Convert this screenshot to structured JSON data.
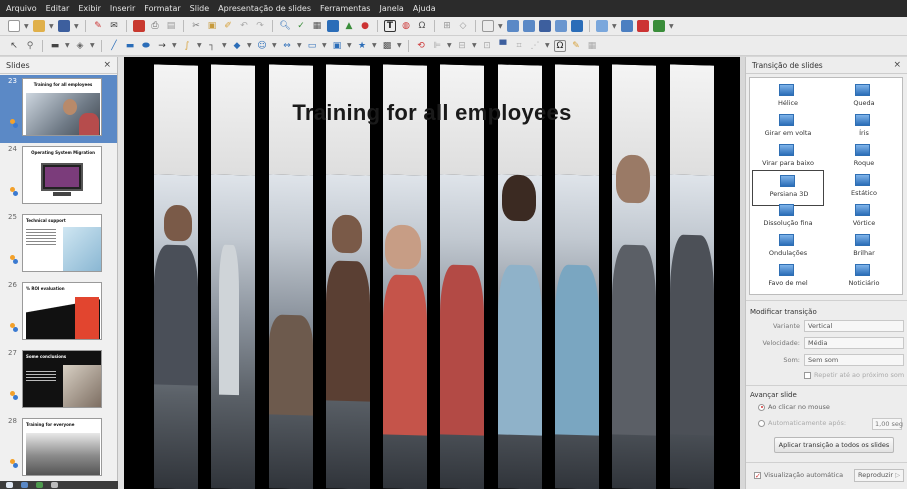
{
  "menu": [
    "Arquivo",
    "Editar",
    "Exibir",
    "Inserir",
    "Formatar",
    "Slide",
    "Apresentação de slides",
    "Ferramentas",
    "Janela",
    "Ajuda"
  ],
  "slides_pane": {
    "title": "Slides",
    "close": "×",
    "slides": [
      {
        "number": "23",
        "title": "Training for all employees",
        "selected": true
      },
      {
        "number": "24",
        "title": "Operating System Migration",
        "selected": false
      },
      {
        "number": "25",
        "title": "Technical support",
        "selected": false
      },
      {
        "number": "26",
        "title": "% ROI evaluation",
        "selected": false
      },
      {
        "number": "27",
        "title": "Some conclusions",
        "selected": false
      },
      {
        "number": "28",
        "title": "Training for everyone",
        "selected": false
      }
    ]
  },
  "stage": {
    "title": "Training for all employees"
  },
  "task_pane": {
    "title": "Transição de slides",
    "close": "×",
    "transitions": [
      {
        "label": "Hélice",
        "selected": false
      },
      {
        "label": "Queda",
        "selected": false
      },
      {
        "label": "Girar em volta",
        "selected": false
      },
      {
        "label": "Íris",
        "selected": false
      },
      {
        "label": "Virar para baixo",
        "selected": false
      },
      {
        "label": "Roque",
        "selected": false
      },
      {
        "label": "Persiana 3D",
        "selected": true
      },
      {
        "label": "Estático",
        "selected": false
      },
      {
        "label": "Dissolução fina",
        "selected": false
      },
      {
        "label": "Vórtice",
        "selected": false
      },
      {
        "label": "Ondulações",
        "selected": false
      },
      {
        "label": "Brilhar",
        "selected": false
      },
      {
        "label": "Favo de mel",
        "selected": false
      },
      {
        "label": "Noticiário",
        "selected": false
      }
    ],
    "modify": {
      "title": "Modificar transição",
      "variant_label": "Variante",
      "variant_value": "Vertical",
      "speed_label": "Velocidade:",
      "speed_value": "Média",
      "sound_label": "Som:",
      "sound_value": "Sem som",
      "repeat_label": "Repetir até ao próximo som"
    },
    "advance": {
      "title": "Avançar slide",
      "on_click_label": "Ao clicar no mouse",
      "auto_label": "Automaticamente após:",
      "auto_value": "1,00 seg"
    },
    "apply_all_label": "Aplicar transição a todos os slides",
    "auto_preview_label": "Visualização automática",
    "play_label": "Reproduzir"
  },
  "colors": {
    "menubar": "#2b2b2b",
    "selection": "#5b89c6",
    "accent_icon": "#2b6db8"
  }
}
